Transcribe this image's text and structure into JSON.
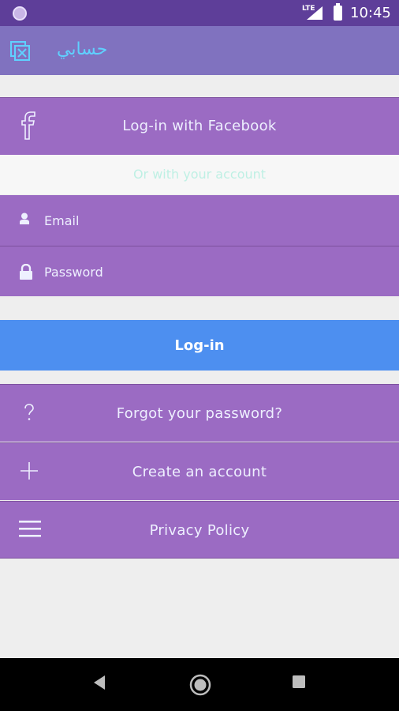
{
  "status_bar": {
    "network": "LTE",
    "time": "10:45"
  },
  "app_bar": {
    "title": "حسابي"
  },
  "facebook": {
    "label": "Log-in with Facebook",
    "icon": "facebook-icon"
  },
  "divider": {
    "text": "Or with your account"
  },
  "form": {
    "email": {
      "placeholder": "Email",
      "value": "",
      "icon": "user-icon"
    },
    "password": {
      "placeholder": "Password",
      "value": "",
      "icon": "lock-icon"
    }
  },
  "login_button": {
    "label": "Log-in"
  },
  "menu": [
    {
      "label": "Forgot your password?",
      "icon": "question-icon"
    },
    {
      "label": "Create an account",
      "icon": "plus-icon"
    },
    {
      "label": "Privacy Policy",
      "icon": "hamburger-menu-icon"
    }
  ],
  "colors": {
    "status_bar": "#5e3e99",
    "app_bar": "#8072bf",
    "row": "#9b6bc3",
    "login_button": "#4d8ff0",
    "title_text": "#5fd1ff",
    "divider_text": "#bff0e4",
    "background": "#eeeeee"
  }
}
